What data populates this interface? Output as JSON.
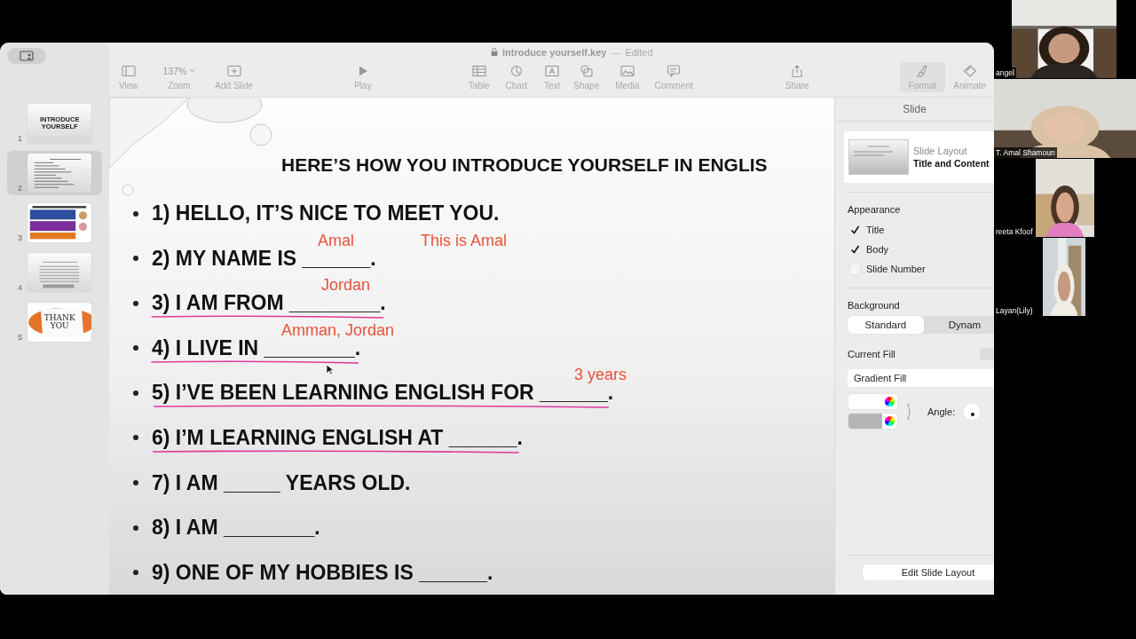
{
  "window": {
    "title": "introduce yourself.key",
    "separator": "—",
    "status": "Edited"
  },
  "toolbar": [
    {
      "kind": "view",
      "label": "View"
    },
    {
      "kind": "zoom",
      "label": "Zoom",
      "value": "137%"
    },
    {
      "kind": "add-slide",
      "label": "Add Slide"
    },
    {
      "kind": "play",
      "label": "Play"
    },
    {
      "kind": "table",
      "label": "Table"
    },
    {
      "kind": "chart",
      "label": "Chart"
    },
    {
      "kind": "text",
      "label": "Text"
    },
    {
      "kind": "shape",
      "label": "Shape"
    },
    {
      "kind": "media",
      "label": "Media"
    },
    {
      "kind": "comment",
      "label": "Comment"
    },
    {
      "kind": "share",
      "label": "Share"
    },
    {
      "kind": "format",
      "label": "Format",
      "selected": true
    },
    {
      "kind": "animate",
      "label": "Animate",
      "selected": false
    }
  ],
  "thumbnails": [
    {
      "number": "1",
      "kind": "title",
      "selected": false,
      "text": "INTRODUCE YOURSELF"
    },
    {
      "number": "2",
      "kind": "list",
      "selected": true
    },
    {
      "number": "3",
      "kind": "colorful",
      "selected": false
    },
    {
      "number": "4",
      "kind": "form",
      "selected": false
    },
    {
      "number": "5",
      "kind": "thanks",
      "selected": false,
      "text": "THANK YOU"
    }
  ],
  "slide": {
    "title": "HERE’S HOW YOU INTRODUCE YOURSELF IN ENGLIS",
    "items": [
      {
        "text": "1) HELLO, IT’S NICE TO MEET YOU.",
        "underlined": false
      },
      {
        "text": "2) MY NAME IS ______.",
        "underlined": false,
        "notes": [
          "Amal",
          "This is Amal"
        ]
      },
      {
        "text": "3) I AM FROM ________.",
        "underlined": true,
        "notes": [
          "Jordan"
        ]
      },
      {
        "text": "4) I LIVE IN ________.",
        "underlined": true,
        "notes": [
          "Amman, Jordan"
        ]
      },
      {
        "text": "5) I’VE BEEN LEARNING ENGLISH FOR ______.",
        "underlined": true,
        "notes": [
          "3 years"
        ]
      },
      {
        "text": "6) I’M LEARNING ENGLISH AT ______.",
        "underlined": true
      },
      {
        "text": "7) I AM _____ YEARS OLD.",
        "underlined": false
      },
      {
        "text": "8) I AM ________.",
        "underlined": false
      },
      {
        "text": "9) ONE OF MY HOBBIES IS ______.",
        "underlined": false
      }
    ]
  },
  "inspector": {
    "tab": "Slide",
    "layout_label": "Slide Layout",
    "layout_value": "Title and Content",
    "appearance": {
      "heading": "Appearance",
      "options": [
        {
          "label": "Title",
          "checked": true
        },
        {
          "label": "Body",
          "checked": true
        },
        {
          "label": "Slide Number",
          "checked": false
        }
      ]
    },
    "background": {
      "heading": "Background",
      "segments": [
        {
          "label": "Standard",
          "selected": true
        },
        {
          "label": "Dynam",
          "selected": false
        }
      ]
    },
    "fill_label": "Current Fill",
    "fill_type": "Gradient Fill",
    "angle_label": "Angle:",
    "edit_button": "Edit Slide Layout"
  },
  "participants": [
    {
      "name": "angel",
      "kind": "curtain"
    },
    {
      "name": "T. Amal Shamoun",
      "kind": "couch"
    },
    {
      "name": "reeta Kfoof",
      "kind": "room"
    },
    {
      "name": "Layan(Lily)",
      "kind": "window"
    }
  ]
}
